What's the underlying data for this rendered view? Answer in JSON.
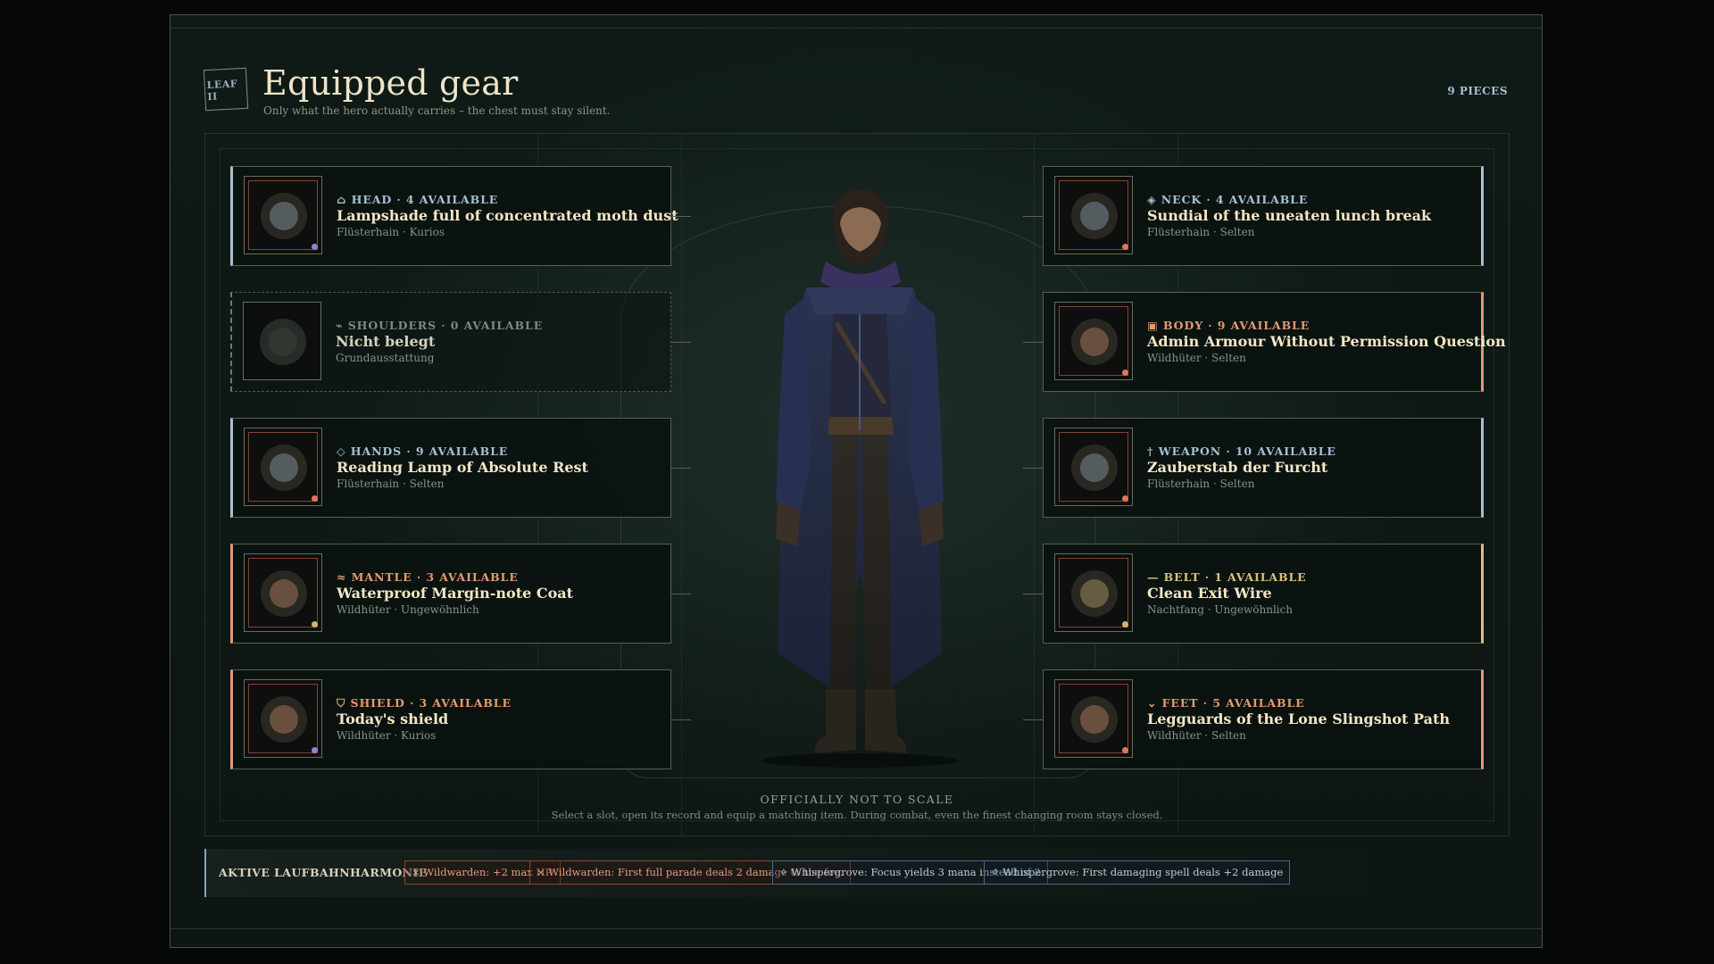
{
  "header": {
    "leaf_badge": "LEAF II",
    "title": "Equipped gear",
    "subtitle": "Only what the hero actually carries – the chest must stay silent.",
    "pieces": "9 PIECES"
  },
  "slots_left": [
    {
      "icon": "⌂",
      "slot": "HEAD · 4 AVAILABLE",
      "name": "Lampshade full of concentrated moth dust",
      "meta": "Flüsterhain · Kurios",
      "accent": "#a8bfd4",
      "dot": "#9a7fd0",
      "empty": false
    },
    {
      "icon": "⌁",
      "slot": "SHOULDERS · 0 AVAILABLE",
      "name": "Nicht belegt",
      "meta": "Grundausstattung",
      "accent": "#7e8780",
      "dot": "",
      "empty": true
    },
    {
      "icon": "◇",
      "slot": "HANDS · 9 AVAILABLE",
      "name": "Reading Lamp of Absolute Rest",
      "meta": "Flüsterhain · Selten",
      "accent": "#a8bfd4",
      "dot": "#e0755a",
      "empty": false
    },
    {
      "icon": "≈",
      "slot": "MANTLE · 3 AVAILABLE",
      "name": "Waterproof Margin-note Coat",
      "meta": "Wildhüter · Ungewöhnlich",
      "accent": "#e29a73",
      "dot": "#d7b36a",
      "empty": false
    },
    {
      "icon": "⛉",
      "slot": "SHIELD · 3 AVAILABLE",
      "name": "Today's shield",
      "meta": "Wildhüter · Kurios",
      "accent": "#e29a73",
      "dot": "#9a7fd0",
      "empty": false
    }
  ],
  "slots_right": [
    {
      "icon": "◈",
      "slot": "NECK · 4 AVAILABLE",
      "name": "Sundial of the uneaten lunch break",
      "meta": "Flüsterhain · Selten",
      "accent": "#a8bfd4",
      "dot": "#e0755a",
      "empty": false
    },
    {
      "icon": "▣",
      "slot": "BODY · 9 AVAILABLE",
      "name": "Admin Armour Without Permission Question",
      "meta": "Wildhüter · Selten",
      "accent": "#e29a73",
      "dot": "#e0755a",
      "empty": false
    },
    {
      "icon": "†",
      "slot": "WEAPON · 10 AVAILABLE",
      "name": "Zauberstab der Furcht",
      "meta": "Flüsterhain · Selten",
      "accent": "#a8bfd4",
      "dot": "#e0755a",
      "empty": false
    },
    {
      "icon": "—",
      "slot": "BELT · 1 AVAILABLE",
      "name": "Clean Exit Wire",
      "meta": "Nachtfang · Ungewöhnlich",
      "accent": "#d9c07e",
      "dot": "#d7b36a",
      "empty": false
    },
    {
      "icon": "⌄",
      "slot": "FEET · 5 AVAILABLE",
      "name": "Legguards of the Lone Slingshot Path",
      "meta": "Wildhüter · Selten",
      "accent": "#e29a73",
      "dot": "#e0755a",
      "empty": false
    }
  ],
  "stage": {
    "caption_title": "OFFICIALLY NOT TO SCALE",
    "caption_text": "Select a slot, open its record and equip a matching item. During combat, even the finest changing room stays closed."
  },
  "harmony": {
    "label": "AKTIVE LAUFBAHNHARMONIE",
    "chips": [
      {
        "text": "× Wildwarden: +2 max HP.",
        "kind": "wild"
      },
      {
        "text": "× Wildwarden: First full parade deals 2 damage to the foe.",
        "kind": "wild"
      },
      {
        "text": "✧ Whispergrove: Focus yields 3 mana instead of 2",
        "kind": "whisp"
      },
      {
        "text": "✧ Whispergrove: First damaging spell deals +2 damage",
        "kind": "whisp"
      }
    ]
  }
}
